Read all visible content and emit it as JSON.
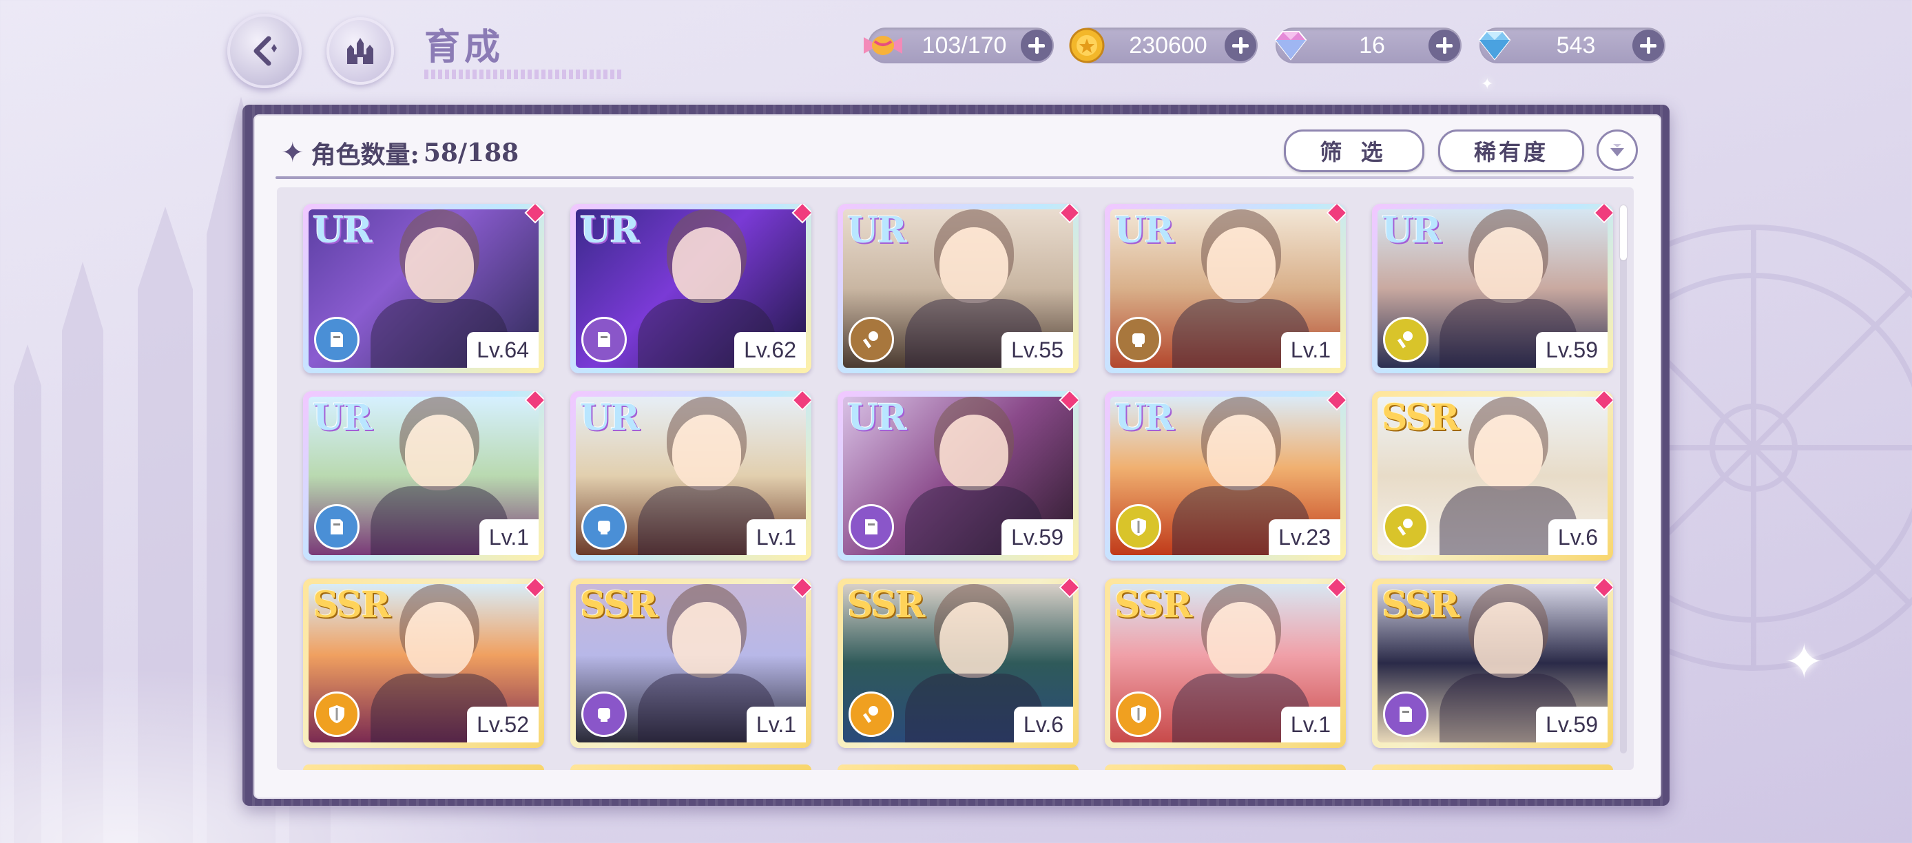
{
  "header": {
    "title": "育成",
    "back_icon": "back-arrow-icon",
    "home_icon": "castle-home-icon"
  },
  "currencies": [
    {
      "name": "candy",
      "icon": "candy-icon",
      "value": "103/170"
    },
    {
      "name": "coin",
      "icon": "gold-coin-icon",
      "value": "230600"
    },
    {
      "name": "pink-gem",
      "icon": "pink-diamond-icon",
      "value": "16"
    },
    {
      "name": "blue-gem",
      "icon": "blue-diamond-icon",
      "value": "543"
    }
  ],
  "panel": {
    "count_label": "角色数量:",
    "count_value": "58/188",
    "filter_label": "筛 选",
    "rarity_label": "稀有度"
  },
  "type_colors": {
    "blue": "#4a8fd6",
    "purple": "#8a56c9",
    "brown": "#a8773d",
    "yellow": "#d9c42a",
    "orange": "#f0a020"
  },
  "cards": [
    {
      "rarity": "UR",
      "level": "Lv.64",
      "type": "blue",
      "type_icon": "book-icon"
    },
    {
      "rarity": "UR",
      "level": "Lv.62",
      "type": "purple",
      "type_icon": "book-icon"
    },
    {
      "rarity": "UR",
      "level": "Lv.55",
      "type": "brown",
      "type_icon": "wand-icon"
    },
    {
      "rarity": "UR",
      "level": "Lv.1",
      "type": "brown",
      "type_icon": "fist-icon"
    },
    {
      "rarity": "UR",
      "level": "Lv.59",
      "type": "yellow",
      "type_icon": "wand-icon"
    },
    {
      "rarity": "UR",
      "level": "Lv.1",
      "type": "blue",
      "type_icon": "book-icon"
    },
    {
      "rarity": "UR",
      "level": "Lv.1",
      "type": "blue",
      "type_icon": "fist-icon"
    },
    {
      "rarity": "UR",
      "level": "Lv.59",
      "type": "purple",
      "type_icon": "book-icon"
    },
    {
      "rarity": "UR",
      "level": "Lv.23",
      "type": "yellow",
      "type_icon": "shield-icon"
    },
    {
      "rarity": "SSR",
      "level": "Lv.6",
      "type": "yellow",
      "type_icon": "wand-icon"
    },
    {
      "rarity": "SSR",
      "level": "Lv.52",
      "type": "orange",
      "type_icon": "shield-icon"
    },
    {
      "rarity": "SSR",
      "level": "Lv.1",
      "type": "purple",
      "type_icon": "fist-icon"
    },
    {
      "rarity": "SSR",
      "level": "Lv.6",
      "type": "orange",
      "type_icon": "wand-icon"
    },
    {
      "rarity": "SSR",
      "level": "Lv.1",
      "type": "orange",
      "type_icon": "shield-icon"
    },
    {
      "rarity": "SSR",
      "level": "Lv.59",
      "type": "purple",
      "type_icon": "book-icon"
    }
  ]
}
